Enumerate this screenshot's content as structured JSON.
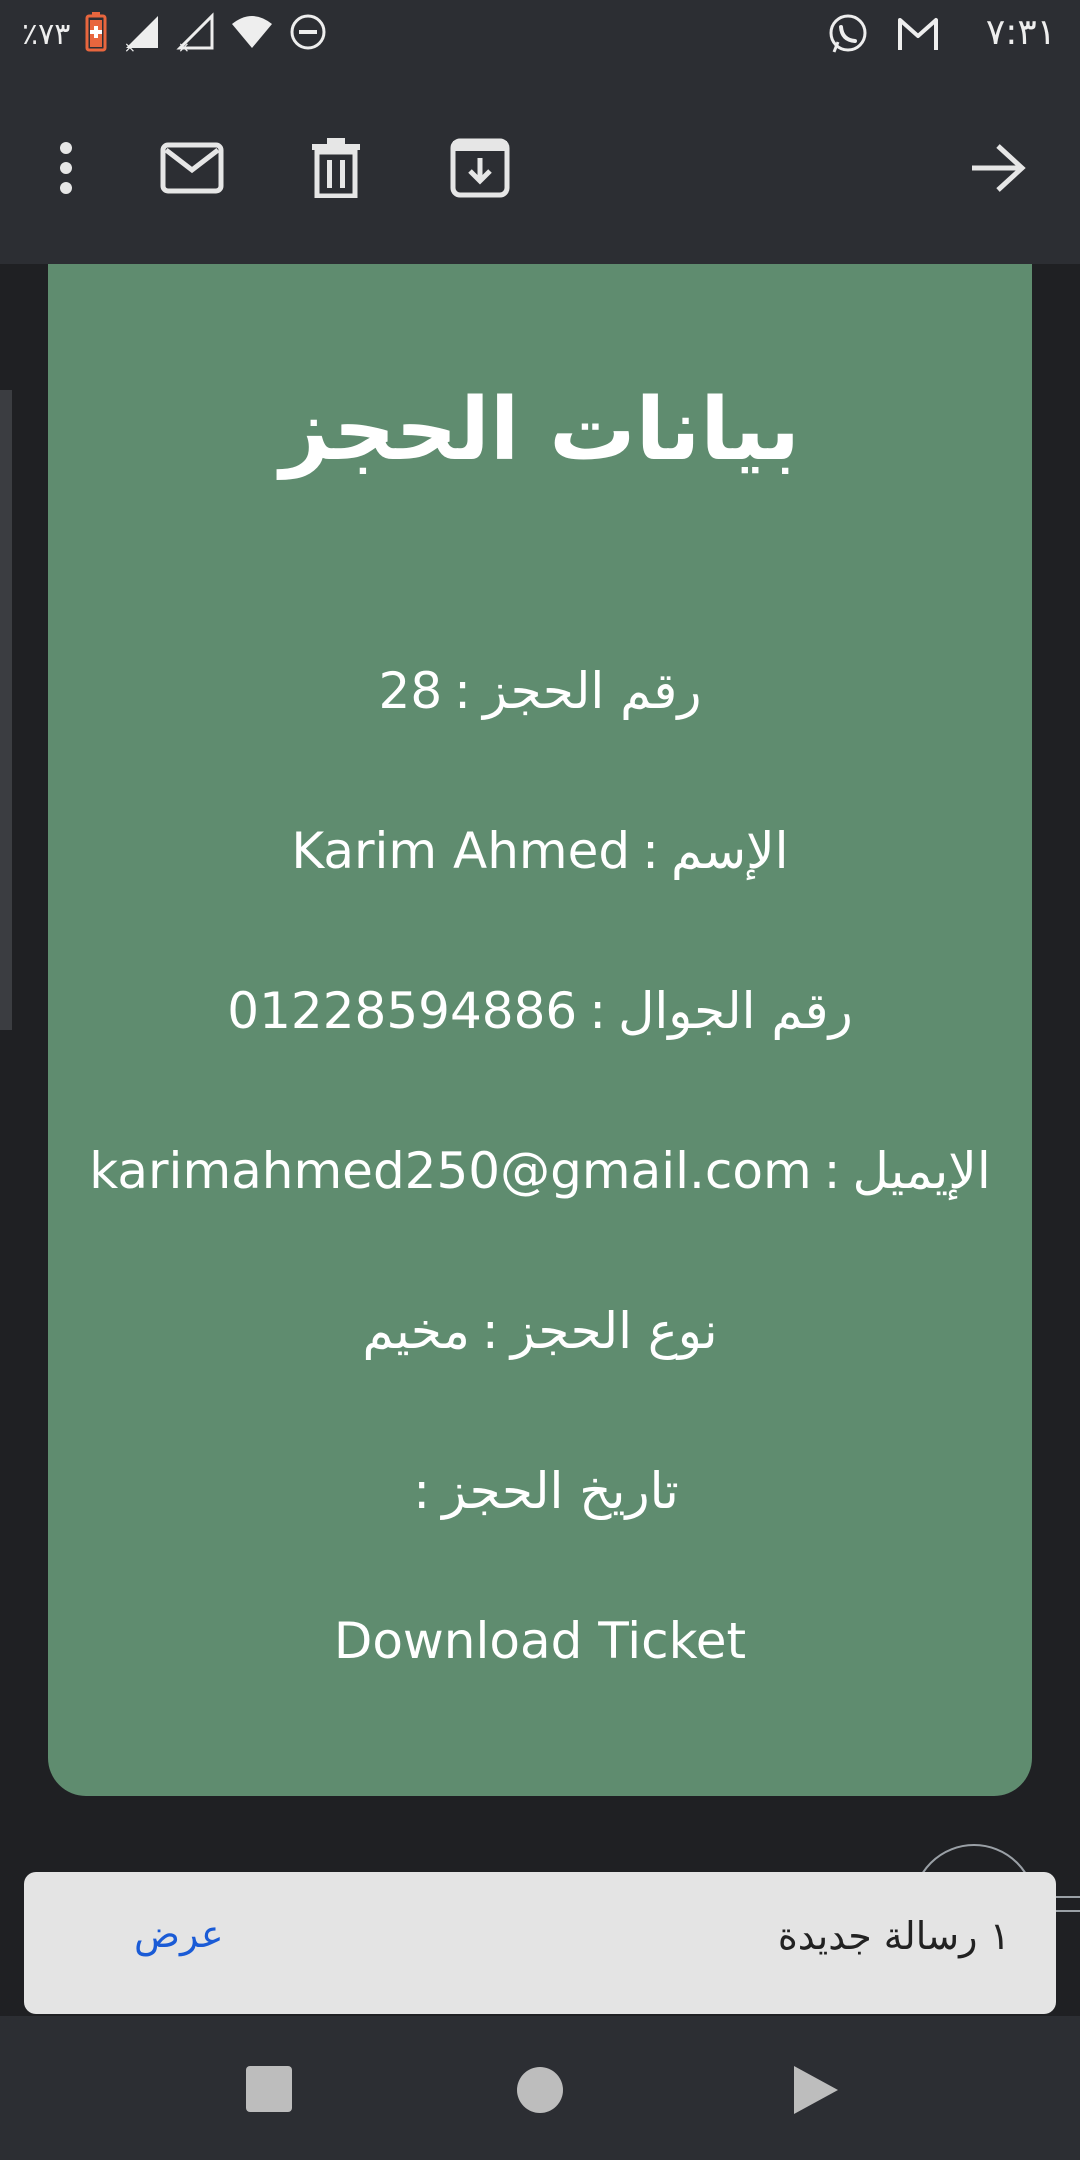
{
  "status_bar": {
    "time": "٧:٣١",
    "battery": "٪٧٣",
    "icons": [
      "whatsapp-icon",
      "gmail-icon",
      "wifi-icon",
      "signal-icon",
      "dnd-icon",
      "battery-icon"
    ]
  },
  "toolbar": {
    "icons": [
      "more-vert-icon",
      "mail-icon",
      "delete-icon",
      "archive-icon",
      "forward-arrow-icon"
    ]
  },
  "card": {
    "title": "بيانات الحجز",
    "background": "#5f8c6f",
    "rows": [
      {
        "label": "رقم الحجز",
        "value": "28"
      },
      {
        "label": "الإسم",
        "value": "Karim Ahmed"
      },
      {
        "label": "رقم الجوال",
        "value": "01228594886"
      },
      {
        "label": "الإيميل",
        "value": "karimahmed250@gmail.com"
      },
      {
        "label": "نوع الحجز",
        "value": "مخيم"
      },
      {
        "label": "تاريخ الحجز",
        "value": ""
      }
    ],
    "download_label": "Download Ticket"
  },
  "snackbar": {
    "message": "١ رسالة جديدة",
    "action": "عرض"
  },
  "navbar": {
    "icons": [
      "recents-square-icon",
      "home-circle-icon",
      "back-triangle-icon"
    ]
  }
}
